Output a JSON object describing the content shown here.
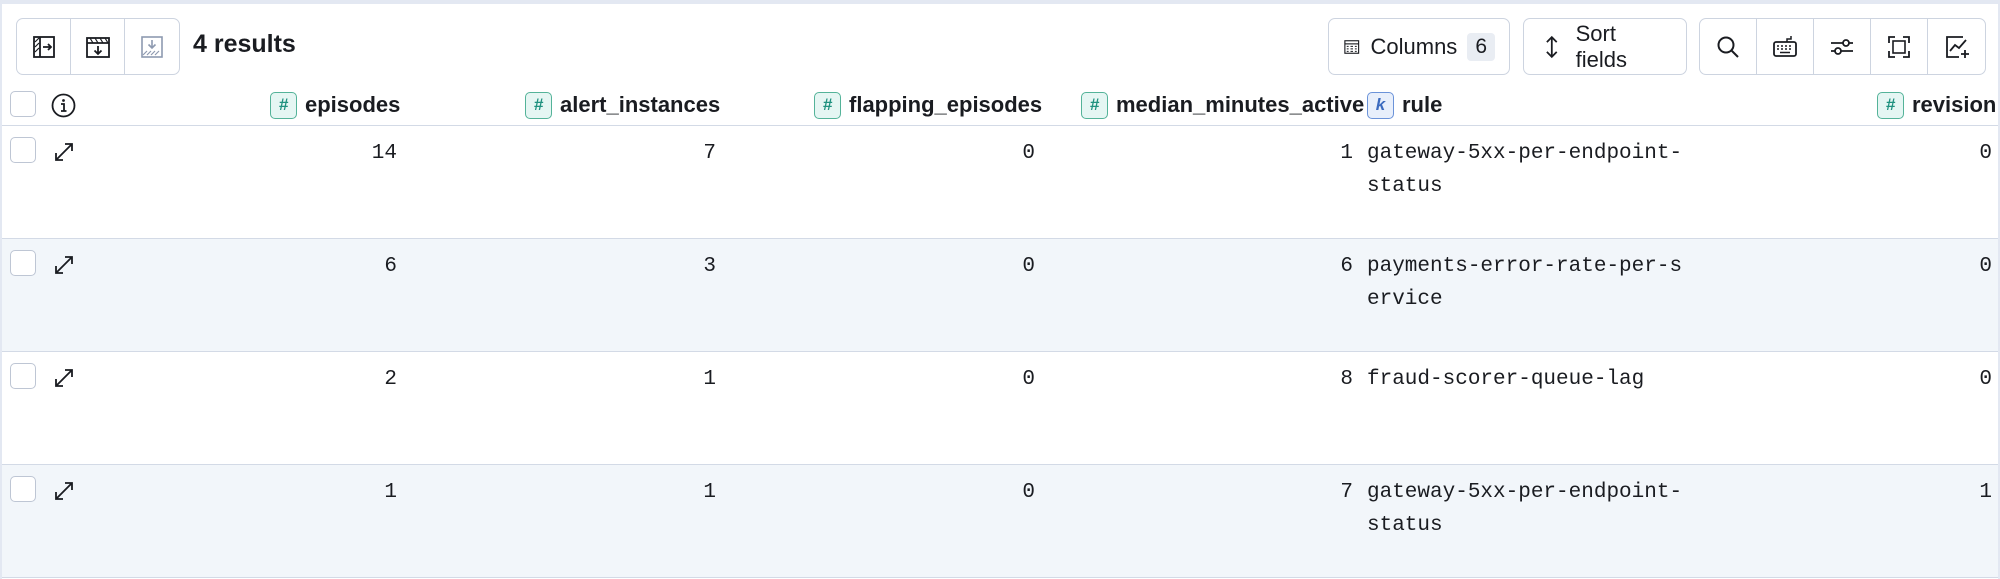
{
  "toolbar": {
    "left_buttons": [
      {
        "name": "toggle-sidebar-icon"
      },
      {
        "name": "export-icon"
      },
      {
        "name": "download-icon"
      }
    ],
    "results_label": "4 results",
    "columns_label": "Columns",
    "columns_count": "6",
    "sort_label": "Sort fields",
    "right_icons": [
      "search-icon",
      "keyboard-icon",
      "settings-sliders-icon",
      "fullscreen-icon",
      "add-chart-icon"
    ]
  },
  "table": {
    "columns": [
      {
        "label": "episodes",
        "type": "#"
      },
      {
        "label": "alert_instances",
        "type": "#"
      },
      {
        "label": "flapping_episodes",
        "type": "#"
      },
      {
        "label": "median_minutes_active",
        "type": "#"
      },
      {
        "label": "rule",
        "type": "k"
      },
      {
        "label": "revision",
        "type": "#"
      }
    ],
    "rows": [
      {
        "episodes": "14",
        "alert_instances": "7",
        "flapping_episodes": "0",
        "median_minutes_active": "1",
        "rule": "gateway-5xx-per-endpoint-status",
        "revision": "0"
      },
      {
        "episodes": "6",
        "alert_instances": "3",
        "flapping_episodes": "0",
        "median_minutes_active": "6",
        "rule": "payments-error-rate-per-service",
        "revision": "0"
      },
      {
        "episodes": "2",
        "alert_instances": "1",
        "flapping_episodes": "0",
        "median_minutes_active": "8",
        "rule": "fraud-scorer-queue-lag",
        "revision": "0"
      },
      {
        "episodes": "1",
        "alert_instances": "1",
        "flapping_episodes": "0",
        "median_minutes_active": "7",
        "rule": "gateway-5xx-per-endpoint-status",
        "revision": "1"
      }
    ]
  },
  "colors": {
    "accent_num": "#209280",
    "accent_kw": "#3c6bbf",
    "row_alt": "#f2f6fa"
  }
}
